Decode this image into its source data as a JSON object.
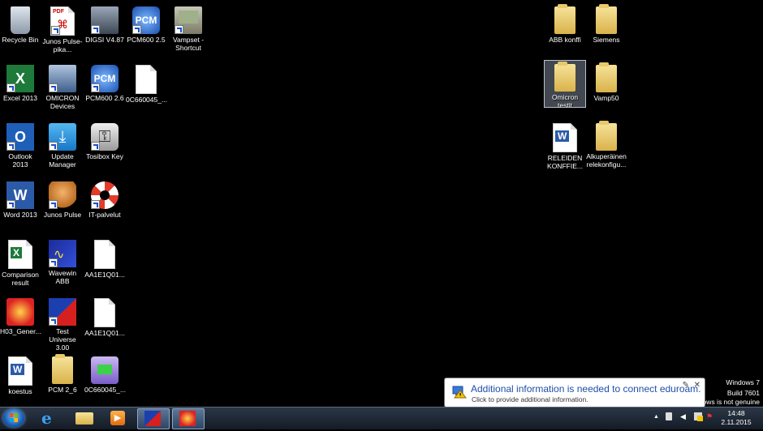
{
  "desktop_icons": [
    {
      "label": "Recycle Bin"
    },
    {
      "label": "Junos Pulse-pika..."
    },
    {
      "label": "DIGSI V4.87"
    },
    {
      "label": "PCM600 2.5"
    },
    {
      "label": "Vampset - Shortcut"
    },
    {
      "label": "Excel 2013"
    },
    {
      "label": "OMICRON Devices"
    },
    {
      "label": "PCM600 2.6"
    },
    {
      "label": "0C660045_..."
    },
    {
      "label": "Outlook 2013"
    },
    {
      "label": "Update Manager"
    },
    {
      "label": "Tosibox Key"
    },
    {
      "label": "Word 2013"
    },
    {
      "label": "Junos Pulse"
    },
    {
      "label": "IT-palvelut"
    },
    {
      "label": "Comparison result"
    },
    {
      "label": "Wavewin ABB"
    },
    {
      "label": "AA1E1Q01..."
    },
    {
      "label": "H03_Gener..."
    },
    {
      "label": "Test Universe 3.00"
    },
    {
      "label": "AA1E1Q01..."
    },
    {
      "label": "koestus"
    },
    {
      "label": "PCM 2_6"
    },
    {
      "label": "0C660045_..."
    },
    {
      "label": "ABB konffi"
    },
    {
      "label": "Siemens"
    },
    {
      "label": "Omicron testit"
    },
    {
      "label": "Vamp50"
    },
    {
      "label": "RELEIDEN KONFFIE..."
    },
    {
      "label": "Alkuperäinen relekonfigu..."
    }
  ],
  "watermark": {
    "line1": "Windows 7",
    "line2": "Build 7601",
    "line3": "This copy of Windows is not genuine"
  },
  "notification": {
    "title": "Additional information is needed to connect eduroam.",
    "body": "Click to provide additional information."
  },
  "taskbar": {
    "clock_time": "14:48",
    "clock_date": "2.11.2015",
    "show_hidden": "▲"
  },
  "colors": {
    "desktop": "#000000",
    "accent": "#1e4fa8"
  }
}
